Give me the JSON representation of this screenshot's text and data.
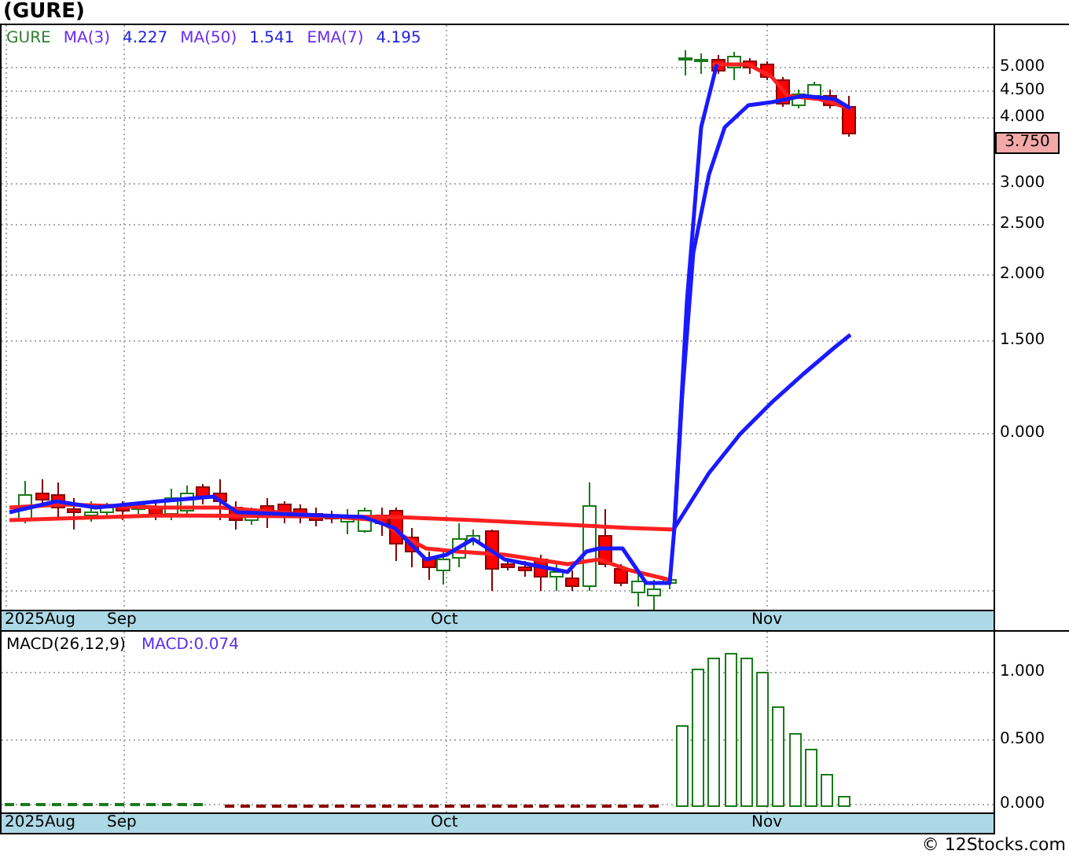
{
  "title": "(GURE)",
  "legend": {
    "symbol": "GURE",
    "indicators": [
      {
        "label": "MA(3)",
        "value": "4.227"
      },
      {
        "label": "MA(50)",
        "value": "1.541"
      },
      {
        "label": "EMA(7)",
        "value": "4.195"
      }
    ]
  },
  "price_axis": {
    "ticks": [
      "5.000",
      "4.500",
      "4.000",
      "3.000",
      "2.500",
      "2.000",
      "1.500",
      "0.000"
    ],
    "last_price": "3.750"
  },
  "date_axis": [
    "2025Aug",
    "Sep",
    "Oct",
    "Nov"
  ],
  "macd": {
    "label": "MACD(26,12,9)",
    "value": "MACD:0.074",
    "ticks": [
      "1.000",
      "0.500",
      "0.000"
    ],
    "date_axis": [
      "2025Aug",
      "Sep",
      "Oct",
      "Nov"
    ]
  },
  "footer": "© 12Stocks.com"
}
